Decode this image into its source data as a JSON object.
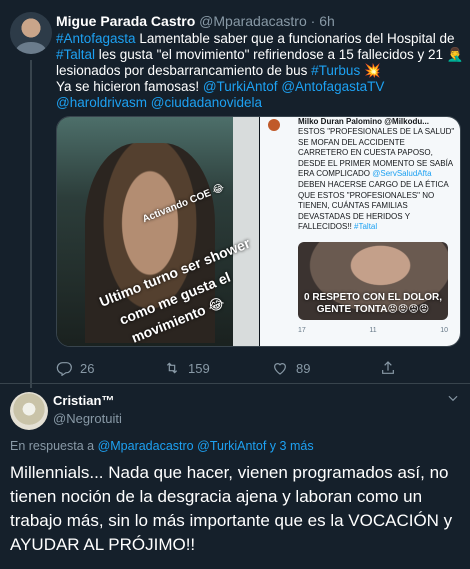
{
  "tweet": {
    "author_name": "Migue Parada Castro",
    "author_handle": "@Mparadacastro",
    "dot": "·",
    "time": "6h",
    "text_parts": [
      {
        "text": "#Antofagasta",
        "link": true
      },
      {
        "text": " Lamentable saber que a funcionarios del Hospital de ",
        "link": false
      },
      {
        "text": "#Taltal",
        "link": true
      },
      {
        "text": " les gusta \"el movimiento\" refiriendose a 15 fallecidos y 21 🤦‍♂️ lesionados por desbarrancamiento de bus ",
        "link": false
      },
      {
        "text": "#Turbus",
        "link": true
      },
      {
        "text": " 💥",
        "link": false
      },
      {
        "text": "\nYa se hicieron famosas! ",
        "link": false
      },
      {
        "text": "@TurkiAntof",
        "link": true
      },
      {
        "text": " ",
        "link": false
      },
      {
        "text": "@AntofagastaTV",
        "link": true
      },
      {
        "text": " ",
        "link": false
      },
      {
        "text": "@haroldrivasm",
        "link": true
      },
      {
        "text": " ",
        "link": false
      },
      {
        "text": "@ciudadanovidela",
        "link": true
      }
    ],
    "media": {
      "left_overlay": [
        "Activando COE 😂",
        "Ultimo turno ser shower",
        "como me gusta el",
        "movimiento 😂"
      ],
      "right_author": "Milko Duran Palomino @Milkodu...",
      "right_text": "ESTOS \"PROFESIONALES DE LA SALUD\" SE MOFAN DEL ACCIDENTE CARRETERO EN CUESTA PAPOSO, DESDE EL PRIMER MOMENTO SE SABÍA ERA COMPLICADO ",
      "right_mention": "@ServSaludAfta",
      "right_text2": " DEBEN HACERSE CARGO DE LA ÉTICA QUE ESTOS \"PROFESIONALES\" NO TIENEN, CUÁNTAS FAMILIAS DEVASTADAS DE HERIDOS Y FALLECIDOS!! ",
      "right_hashtag": "#Taltal",
      "right_caption": "0 RESPETO CON EL DOLOR, GENTE TONTA😡😡😡😡",
      "right_counts": [
        "17",
        "11",
        "10"
      ]
    },
    "actions": {
      "reply_count": "26",
      "retweet_count": "159",
      "like_count": "89"
    }
  },
  "reply": {
    "author_name": "Cristian™",
    "author_handle": "@Negrotuiti",
    "reply_prefix": "En respuesta a ",
    "reply_mention1": "@Mparadacastro",
    "reply_mention2": "@TurkiAntof",
    "reply_suffix": " y 3 más",
    "text": "Millennials... Nada que hacer, vienen programados así, no tienen noción de la desgracia ajena y laboran como un trabajo más, sin lo más importante que es la VOCACIÓN y AYUDAR AL PRÓJIMO!!"
  },
  "colors": {
    "background": "#15202b",
    "link": "#1da1f2",
    "muted": "#8899a6",
    "border": "#38444d"
  },
  "icons": [
    "reply-icon",
    "retweet-icon",
    "like-icon",
    "share-icon",
    "chevron-down-icon"
  ]
}
